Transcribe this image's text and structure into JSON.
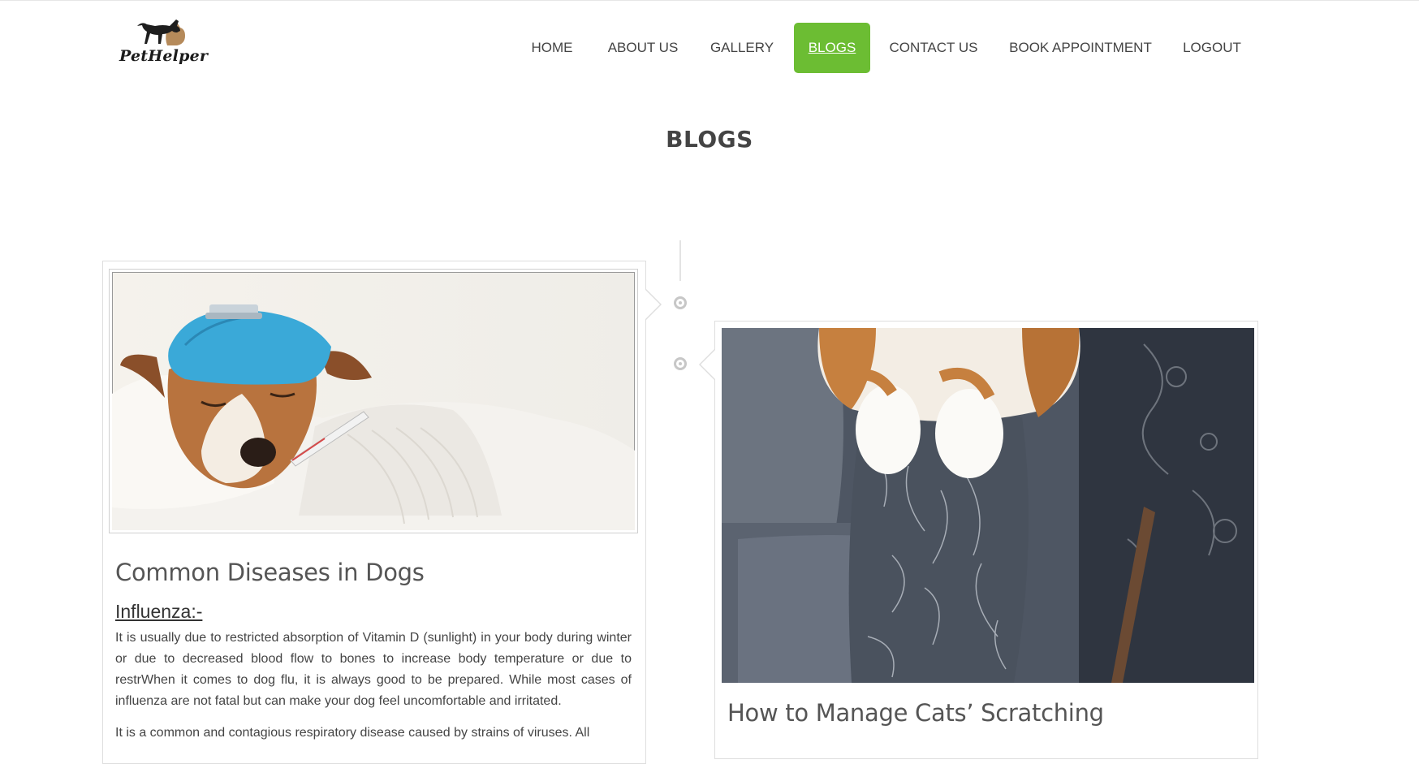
{
  "brand": {
    "logo_text": "PetHelper"
  },
  "nav": {
    "items": [
      {
        "label": "HOME"
      },
      {
        "label": "ABOUT US"
      },
      {
        "label": "GALLERY"
      },
      {
        "label": "BLOGS",
        "active": true
      },
      {
        "label": "CONTACT US"
      },
      {
        "label": "BOOK APPOINTMENT"
      },
      {
        "label": "LOGOUT"
      }
    ]
  },
  "page": {
    "title": "BLOGS"
  },
  "posts": [
    {
      "title": "Common Diseases in Dogs",
      "image_desc": "sick dog with ice pack and thermometer",
      "section_heading": "Influenza:-",
      "paragraphs": [
        "It is usually due to restricted absorption of Vitamin D (sunlight) in your body during winter or due to decreased blood flow to bones to increase body temperature or due to restrWhen it comes to dog flu, it is always good to be prepared. While most cases of influenza are not fatal but can make your dog feel uncomfortable and irritated.",
        "It is a common and contagious respiratory disease caused by strains of viruses. All"
      ]
    },
    {
      "title": "How to Manage Cats’ Scratching",
      "image_desc": "cat paws on scratched sofa arm"
    }
  ],
  "colors": {
    "accent": "#6cbd33",
    "text": "#444444"
  }
}
